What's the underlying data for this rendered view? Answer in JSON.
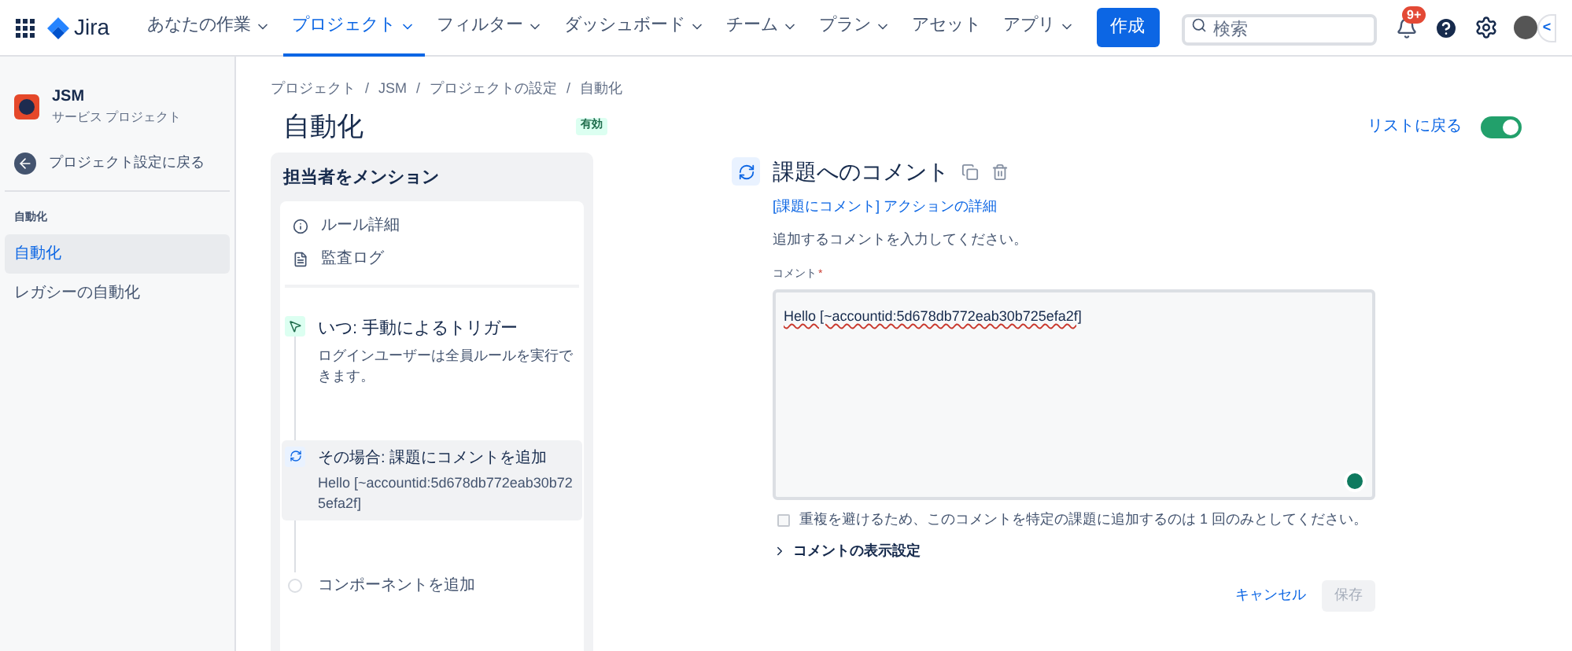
{
  "topbar": {
    "product": "Jira",
    "nav": [
      {
        "label": "あなたの作業",
        "selected": false,
        "dropdown": true
      },
      {
        "label": "プロジェクト",
        "selected": true,
        "dropdown": true
      },
      {
        "label": "フィルター",
        "selected": false,
        "dropdown": true
      },
      {
        "label": "ダッシュボード",
        "selected": false,
        "dropdown": true
      },
      {
        "label": "チーム",
        "selected": false,
        "dropdown": true
      },
      {
        "label": "プラン",
        "selected": false,
        "dropdown": true
      },
      {
        "label": "アセット",
        "selected": false,
        "dropdown": false
      },
      {
        "label": "アプリ",
        "selected": false,
        "dropdown": true
      }
    ],
    "create": "作成",
    "search": {
      "placeholder": "検索"
    },
    "notification_badge": "9+",
    "collapse": "<"
  },
  "sidebar": {
    "project": {
      "name": "JSM",
      "type": "サービス プロジェクト"
    },
    "back": "プロジェクト設定に戻る",
    "section": "自動化",
    "items": [
      {
        "label": "自動化",
        "selected": true
      },
      {
        "label": "レガシーの自動化",
        "selected": false
      }
    ]
  },
  "breadcrumbs": [
    "プロジェクト",
    "JSM",
    "プロジェクトの設定",
    "自動化"
  ],
  "breadcrumb_separator": "/",
  "title": "自動化",
  "status": "有効",
  "back_to_list": "リストに戻る",
  "rule_enabled": true,
  "rule": {
    "name": "担当者をメンション",
    "links": [
      "ルール詳細",
      "監査ログ"
    ],
    "steps": [
      {
        "kind": "trigger",
        "title": "いつ: 手動によるトリガー",
        "detail": "ログインユーザーは全員ルールを実行できます。",
        "selected": false
      },
      {
        "kind": "action",
        "title": "その場合: 課題にコメントを追加",
        "detail": "Hello [~accountid:5d678db772eab30b725efa2f]",
        "selected": true
      },
      {
        "kind": "add",
        "title": "コンポーネントを追加",
        "selected": false
      }
    ]
  },
  "detail": {
    "title": "課題へのコメント",
    "link": "[課題にコメント] アクションの詳細",
    "instruction": "追加するコメントを入力してください。",
    "field_label": "コメント",
    "required_mark": "*",
    "value": "Hello [~accountid:5d678db772eab30b725efa2f]",
    "once": {
      "label": "重複を避けるため、このコメントを特定の課題に追加するのは 1 回のみとしてください。",
      "checked": false
    },
    "visibility": {
      "label": "コメントの表示設定",
      "expanded": false
    },
    "cancel": "キャンセル",
    "save": {
      "label": "保存",
      "disabled": true
    }
  }
}
